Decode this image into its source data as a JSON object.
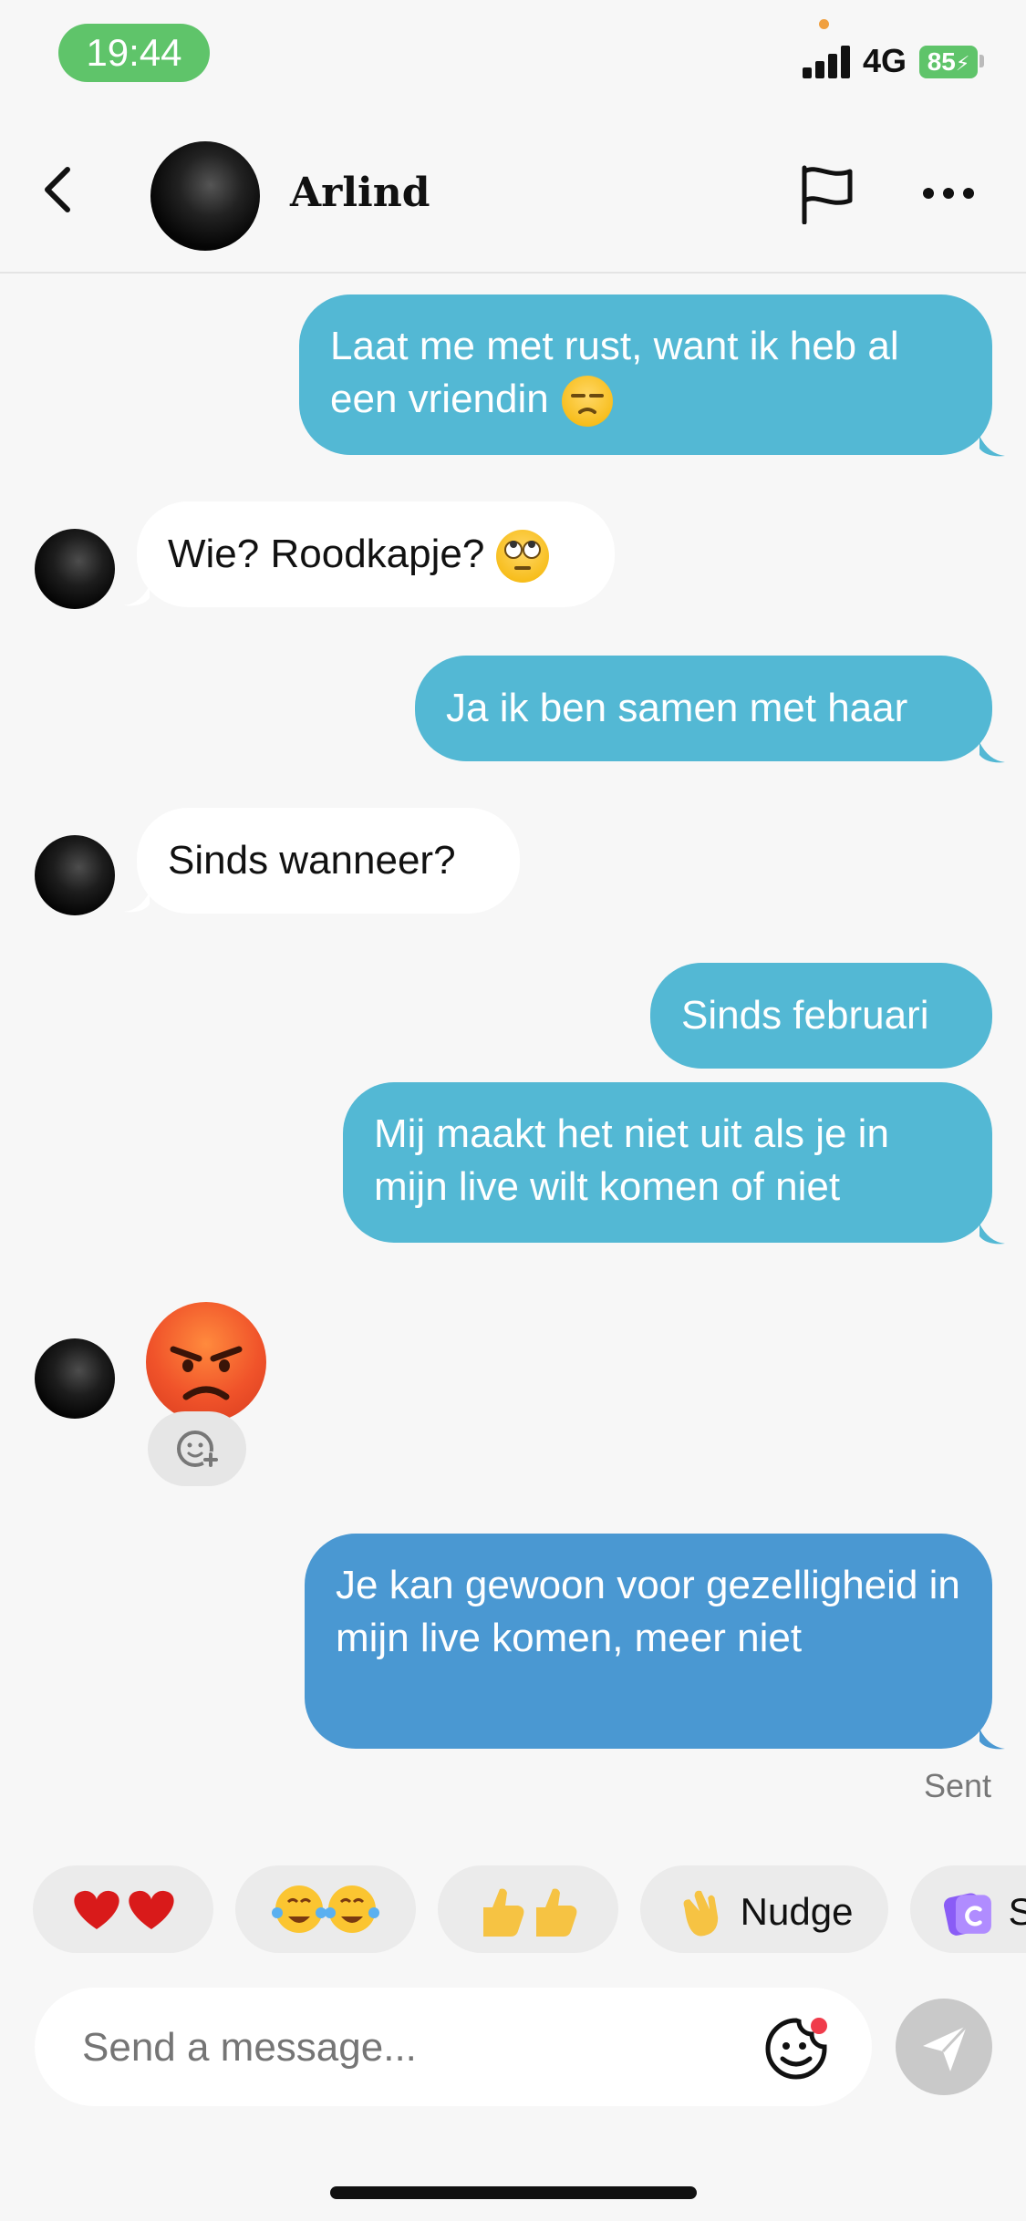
{
  "status_bar": {
    "time": "19:44",
    "network": "4G",
    "battery": "85",
    "accent": "#5fc46a"
  },
  "header": {
    "contact_name": "Arlind",
    "icons": [
      "back-chevron-icon",
      "flag-icon",
      "more-dots-icon"
    ]
  },
  "messages": [
    {
      "direction": "out",
      "text": "Laat me met rust, want ik heb al een vriendin",
      "emoji": "unamused-face"
    },
    {
      "direction": "in",
      "text": "Wie? Roodkapje?",
      "emoji": "eye-roll-face"
    },
    {
      "direction": "out",
      "text": "Ja ik ben samen met haar"
    },
    {
      "direction": "in",
      "text": "Sinds wanneer?"
    },
    {
      "direction": "out",
      "text": "Sinds februari"
    },
    {
      "direction": "out",
      "text": "Mij maakt het niet uit als je in mijn live wilt komen of niet"
    },
    {
      "direction": "in",
      "emoji": "angry-face"
    },
    {
      "direction": "out",
      "text": "Je kan gewoon voor gezelligheid in mijn live komen, meer niet"
    }
  ],
  "sent_status": "Sent",
  "quick_reactions": [
    {
      "icon": "double-red-heart"
    },
    {
      "icon": "double-tears-of-joy"
    },
    {
      "icon": "double-thumbs-up"
    },
    {
      "icon": "waving-hand",
      "label": "Nudge"
    },
    {
      "icon": "purple-sticker",
      "label": "S"
    }
  ],
  "composer": {
    "placeholder": "Send a message..."
  },
  "colors": {
    "outgoing_bubble": "#53b8d4",
    "outgoing_bubble_last": "#4a98d2",
    "incoming_bubble": "#ffffff",
    "background": "#f7f7f7"
  }
}
